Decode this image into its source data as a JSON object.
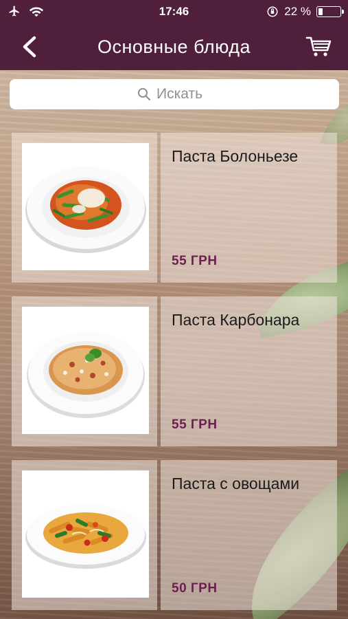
{
  "status_bar": {
    "time": "17:46",
    "battery_text": "22 %",
    "battery_level": 0.22,
    "icons": [
      "airplane-icon",
      "wifi-icon",
      "orientation-lock-icon",
      "battery-icon"
    ]
  },
  "nav": {
    "title": "Основные блюда",
    "back_icon": "chevron-left-icon",
    "cart_icon": "cart-icon"
  },
  "search": {
    "placeholder": "Искать",
    "value": ""
  },
  "colors": {
    "brand": "#4f1f3b",
    "price": "#6b1f4f"
  },
  "dishes": [
    {
      "name": "Паста Болоньезе",
      "price": "55 ГРН",
      "image": "pasta-bolognese-plate"
    },
    {
      "name": "Паста Карбонара",
      "price": "55 ГРН",
      "image": "pasta-carbonara-plate"
    },
    {
      "name": "Паста с овощами",
      "price": "50 ГРН",
      "image": "pasta-vegetables-plate"
    }
  ]
}
